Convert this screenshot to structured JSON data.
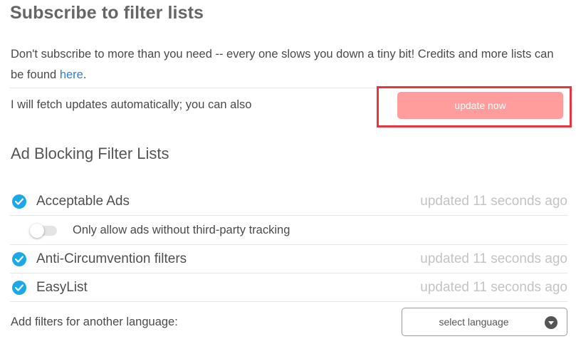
{
  "header": {
    "title": "Subscribe to filter lists"
  },
  "intro": {
    "text": "Don't subscribe to more than you need -- every one slows you down a tiny bit! Credits and more lists can be found ",
    "link_text": "here",
    "suffix": "."
  },
  "updates": {
    "text": "I will fetch updates automatically; you can also",
    "button_label": "update now"
  },
  "section": {
    "title": "Ad Blocking Filter Lists"
  },
  "filter_lists": [
    {
      "name": "Acceptable Ads",
      "status": "updated 11 seconds ago",
      "checked": true
    },
    {
      "name": "Anti-Circumvention filters",
      "status": "updated 11 seconds ago",
      "checked": true
    },
    {
      "name": "EasyList",
      "status": "updated 11 seconds ago",
      "checked": true
    }
  ],
  "acceptable_ads_option": {
    "label": "Only allow ads without third-party tracking",
    "enabled": false
  },
  "language": {
    "label": "Add filters for another language:",
    "select_value": "select language"
  },
  "colors": {
    "accent": "#1aa8e6",
    "button": "#ff9c9c",
    "link": "#2d7fd6",
    "highlight_border": "#e8343e"
  },
  "icons": {
    "check": "check-circle-icon",
    "caret": "chevron-down-icon"
  }
}
